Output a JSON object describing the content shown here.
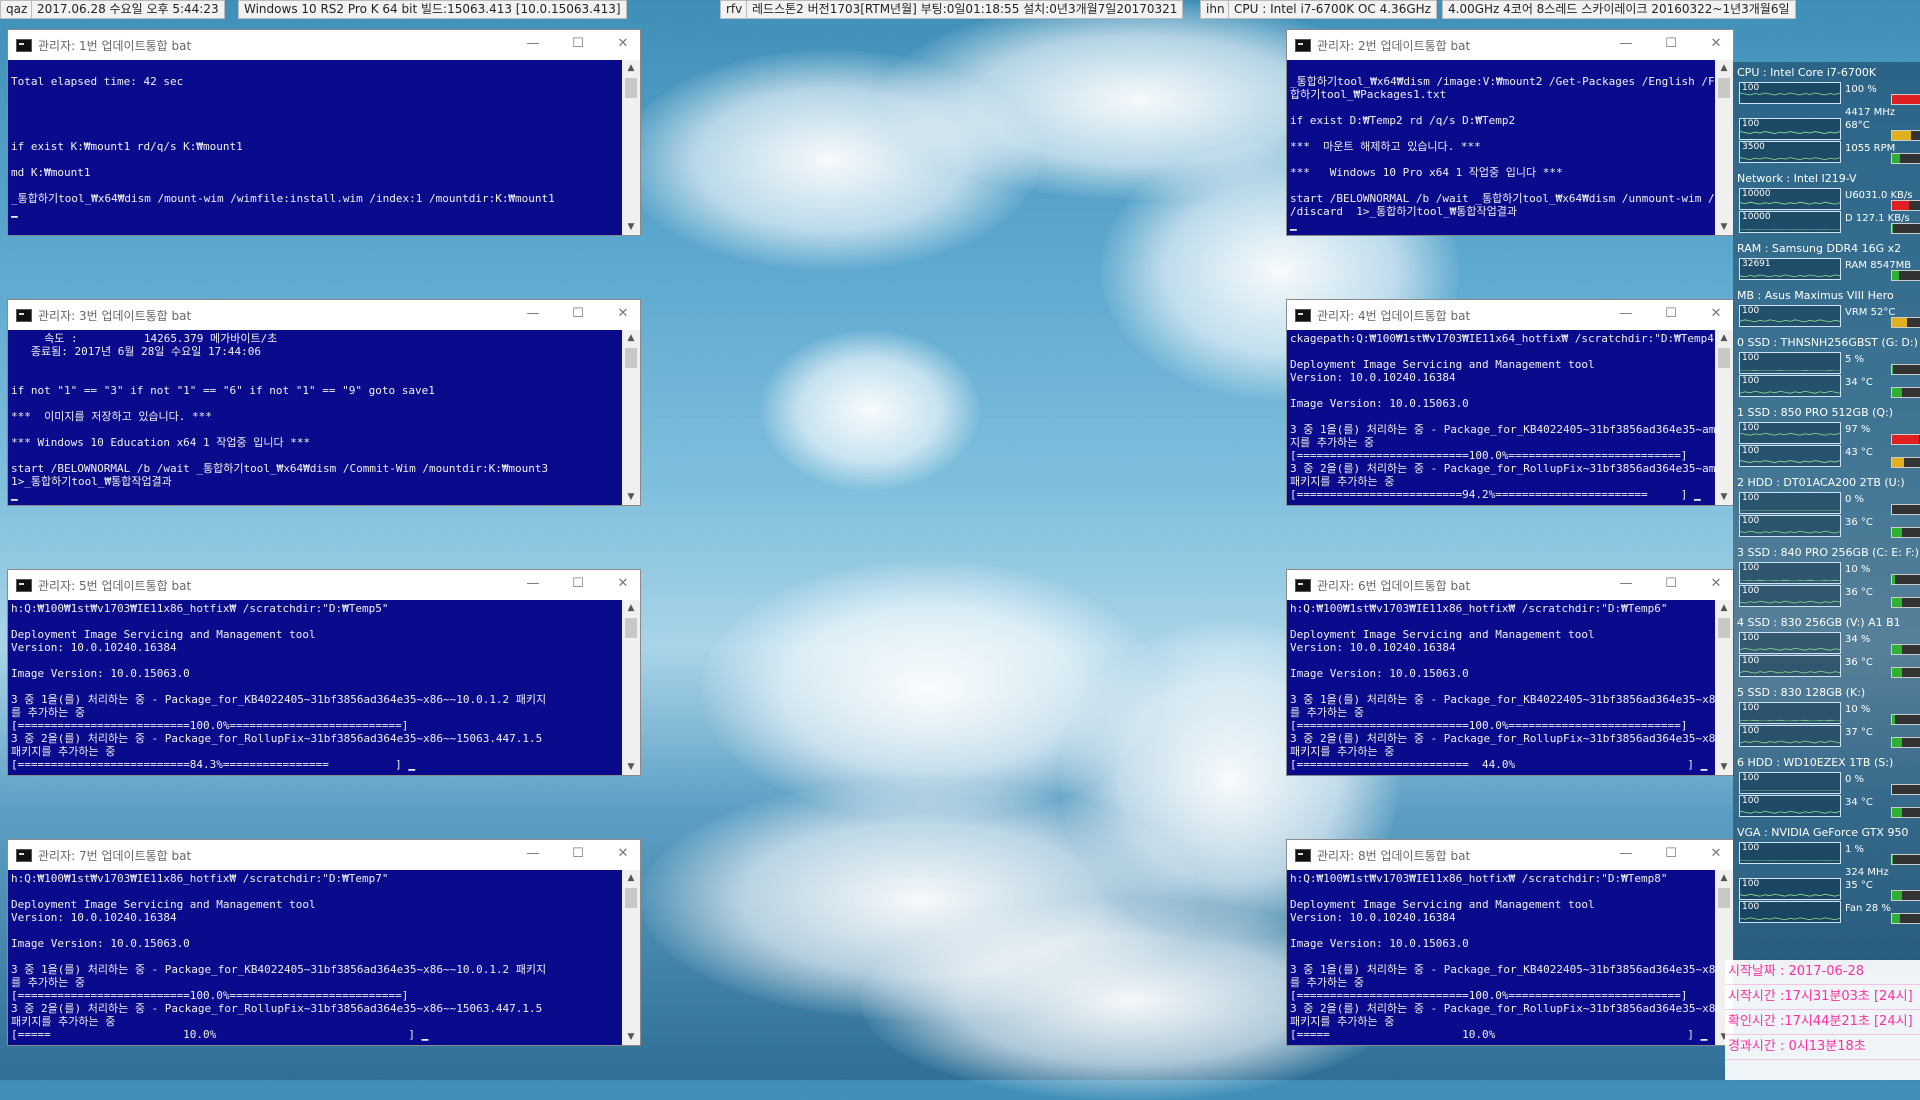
{
  "topbar": {
    "items": [
      "qaz",
      "2017.06.28 수요일  오후 5:44:23",
      "Windows 10 RS2 Pro K 64 bit 빌드:15063.413 [10.0.15063.413]",
      "rfv",
      "레드스톤2 버전1703[RTM년월] 부팅:0일01:18:55 설치:0년3개월7일20170321",
      "ihn",
      "CPU : Intel i7-6700K OC 4.36GHz",
      "4.00GHz 4코어 8스레드 스카이레이크 20160322~1년3개월6일"
    ]
  },
  "windows": [
    {
      "title": "관리자:  1번 업데이트통합 bat",
      "lines": [
        "",
        "Total elapsed time: 42 sec",
        "",
        "",
        "",
        "",
        "if exist K:₩mount1 rd/q/s K:₩mount1",
        "",
        "md K:₩mount1",
        "",
        "_통합하기tool_₩x64₩dism /mount-wim /wimfile:install.wim /index:1 /mountdir:K:₩mount1",
        "▁"
      ]
    },
    {
      "title": "관리자:  2번 업데이트통합 bat",
      "lines": [
        "",
        "_통합하기tool_₩x64₩dism /image:V:₩mount2 /Get-Packages /English /Format:Table >_통",
        "합하기tool_₩Packages1.txt",
        "",
        "if exist D:₩Temp2 rd /q/s D:₩Temp2",
        "",
        "***  마운트 해제하고 있습니다. ***",
        "",
        "***   Windows 10 Pro x64 1 작업중 입니다 ***",
        "",
        "start /BELOWNORMAL /b /wait _통합하기tool_₩x64₩dism /unmount-wim /mountdir:V:₩mount2",
        "/discard  1>_통합하기tool_₩통합작업결과",
        "▁"
      ]
    },
    {
      "title": "관리자:  3번 업데이트통합 bat",
      "lines": [
        "     속도 :          14265.379 메가바이트/초",
        "   종료됨: 2017년 6월 28일 수요일 17:44:06",
        "",
        "",
        "if not \"1\" == \"3\" if not \"1\" == \"6\" if not \"1\" == \"9\" goto save1",
        "",
        "***  이미지를 저장하고 있습니다. ***",
        "",
        "*** Windows 10 Education x64 1 작업중 입니다 ***",
        "",
        "start /BELOWNORMAL /b /wait _통합하기tool_₩x64₩dism /Commit-Wim /mountdir:K:₩mount3",
        "1>_통합하기tool_₩통합작업결과",
        "▁"
      ]
    },
    {
      "title": "관리자:  4번 업데이트통합 bat",
      "lines": [
        "ckagepath:Q:₩100₩1st₩v1703₩IE11x64_hotfix₩ /scratchdir:\"D:₩Temp4\"",
        "",
        "Deployment Image Servicing and Management tool",
        "Version: 10.0.10240.16384",
        "",
        "Image Version: 10.0.15063.0",
        "",
        "3 중 1을(를) 처리하는 중 - Package_for_KB4022405~31bf3856ad364e35~amd64~~10.0.1.2 패키",
        "지를 추가하는 중",
        "[==========================100.0%==========================]",
        "3 중 2을(를) 처리하는 중 - Package_for_RollupFix~31bf3856ad364e35~amd64~~15063.447.1.5",
        "패키지를 추가하는 중",
        "[=========================94.2%=======================     ] ▁"
      ]
    },
    {
      "title": "관리자:  5번 업데이트통합 bat",
      "lines": [
        "h:Q:₩100₩1st₩v1703₩IE11x86_hotfix₩ /scratchdir:\"D:₩Temp5\"",
        "",
        "Deployment Image Servicing and Management tool",
        "Version: 10.0.10240.16384",
        "",
        "Image Version: 10.0.15063.0",
        "",
        "3 중 1을(를) 처리하는 중 - Package_for_KB4022405~31bf3856ad364e35~x86~~10.0.1.2 패키지",
        "를 추가하는 중",
        "[==========================100.0%==========================]",
        "3 중 2을(를) 처리하는 중 - Package_for_RollupFix~31bf3856ad364e35~x86~~15063.447.1.5",
        "패키지를 추가하는 중",
        "[==========================84.3%================          ] ▁"
      ]
    },
    {
      "title": "관리자:  6번 업데이트통합 bat",
      "lines": [
        "h:Q:₩100₩1st₩v1703₩IE11x86_hotfix₩ /scratchdir:\"D:₩Temp6\"",
        "",
        "Deployment Image Servicing and Management tool",
        "Version: 10.0.10240.16384",
        "",
        "Image Version: 10.0.15063.0",
        "",
        "3 중 1을(를) 처리하는 중 - Package_for_KB4022405~31bf3856ad364e35~x86~~10.0.1.2 패키지",
        "를 추가하는 중",
        "[==========================100.0%==========================]",
        "3 중 2을(를) 처리하는 중 - Package_for_RollupFix~31bf3856ad364e35~x86~~15063.447.1.5",
        "패키지를 추가하는 중",
        "[==========================  44.0%                          ] ▁"
      ]
    },
    {
      "title": "관리자:  7번 업데이트통합 bat",
      "lines": [
        "h:Q:₩100₩1st₩v1703₩IE11x86_hotfix₩ /scratchdir:\"D:₩Temp7\"",
        "",
        "Deployment Image Servicing and Management tool",
        "Version: 10.0.10240.16384",
        "",
        "Image Version: 10.0.15063.0",
        "",
        "3 중 1을(를) 처리하는 중 - Package_for_KB4022405~31bf3856ad364e35~x86~~10.0.1.2 패키지",
        "를 추가하는 중",
        "[==========================100.0%==========================]",
        "3 중 2을(를) 처리하는 중 - Package_for_RollupFix~31bf3856ad364e35~x86~~15063.447.1.5",
        "패키지를 추가하는 중",
        "[=====                    10.0%                             ] ▁"
      ]
    },
    {
      "title": "관리자:  8번 업데이트통합 bat",
      "lines": [
        "h:Q:₩100₩1st₩v1703₩IE11x86_hotfix₩ /scratchdir:\"D:₩Temp8\"",
        "",
        "Deployment Image Servicing and Management tool",
        "Version: 10.0.10240.16384",
        "",
        "Image Version: 10.0.15063.0",
        "",
        "3 중 1을(를) 처리하는 중 - Package_for_KB4022405~31bf3856ad364e35~x86~~10.0.1.2 패키지",
        "를 추가하는 중",
        "[==========================100.0%==========================]",
        "3 중 2을(를) 처리하는 중 - Package_for_RollupFix~31bf3856ad364e35~x86~~15063.447.1.5",
        "패키지를 추가하는 중",
        "[=====                    10.0%                             ] ▁"
      ]
    }
  ],
  "monitor": {
    "sections": [
      {
        "head": "CPU : Intel Core i7-6700K",
        "rows": [
          {
            "g": "100",
            "v": "100 %",
            "fill": 1.0,
            "color": "#e02020"
          },
          {
            "g": "",
            "v": "4417 MHz",
            "fill": 0,
            "color": ""
          },
          {
            "g": "100",
            "v": "68°C",
            "fill": 0.68,
            "color": "#e0b020"
          },
          {
            "g": "3500",
            "v": "1055 RPM",
            "fill": 0.3,
            "color": "#30b030"
          }
        ]
      },
      {
        "head": "Network : Intel I219-V",
        "rows": [
          {
            "g": "10000",
            "v": "U6031.0 KB/s",
            "fill": 0.6,
            "color": "#e02020"
          },
          {
            "g": "10000",
            "v": "D  127.1 KB/s",
            "fill": 0.02,
            "color": "#30b030"
          }
        ]
      },
      {
        "head": "RAM : Samsung DDR4 16G x2",
        "rows": [
          {
            "g": "32691",
            "v": "RAM  8547MB",
            "fill": 0.26,
            "color": "#30b030"
          }
        ]
      },
      {
        "head": "MB : Asus Maximus VIII Hero",
        "rows": [
          {
            "g": "100",
            "v": "VRM  52°C",
            "fill": 0.52,
            "color": "#e0b020"
          }
        ]
      },
      {
        "head": "0 SSD : THNSNH256GBST (G: D:)",
        "rows": [
          {
            "g": "100",
            "v": "5 %",
            "fill": 0.05,
            "color": "#30b030"
          },
          {
            "g": "100",
            "v": "34 °C",
            "fill": 0.34,
            "color": "#30b030"
          }
        ]
      },
      {
        "head": "1 SSD : 850 PRO 512GB (Q:)",
        "rows": [
          {
            "g": "100",
            "v": "97 %",
            "fill": 0.97,
            "color": "#e02020"
          },
          {
            "g": "100",
            "v": "43 °C",
            "fill": 0.43,
            "color": "#e0b020"
          }
        ]
      },
      {
        "head": "2 HDD : DT01ACA200 2TB (U:)",
        "rows": [
          {
            "g": "100",
            "v": "0 %",
            "fill": 0,
            "color": "#30b030"
          },
          {
            "g": "100",
            "v": "36 °C",
            "fill": 0.36,
            "color": "#30b030"
          }
        ]
      },
      {
        "head": "3 SSD : 840 PRO 256GB (C: E: F:)",
        "rows": [
          {
            "g": "100",
            "v": "10 %",
            "fill": 0.1,
            "color": "#30b030"
          },
          {
            "g": "100",
            "v": "36 °C",
            "fill": 0.36,
            "color": "#30b030"
          }
        ]
      },
      {
        "head": "4 SSD : 830 256GB (V:) A1 B1",
        "rows": [
          {
            "g": "100",
            "v": "34 %",
            "fill": 0.34,
            "color": "#30b030"
          },
          {
            "g": "100",
            "v": "36 °C",
            "fill": 0.36,
            "color": "#30b030"
          }
        ]
      },
      {
        "head": "5 SSD : 830 128GB (K:)",
        "rows": [
          {
            "g": "100",
            "v": "10 %",
            "fill": 0.1,
            "color": "#30b030"
          },
          {
            "g": "100",
            "v": "37 °C",
            "fill": 0.37,
            "color": "#30b030"
          }
        ]
      },
      {
        "head": "6 HDD : WD10EZEX 1TB (S:)",
        "rows": [
          {
            "g": "100",
            "v": "0 %",
            "fill": 0,
            "color": "#30b030"
          },
          {
            "g": "100",
            "v": "34 °C",
            "fill": 0.34,
            "color": "#30b030"
          }
        ]
      },
      {
        "head": "VGA : NVIDIA GeForce GTX 950",
        "rows": [
          {
            "g": "100",
            "v": "1 %",
            "fill": 0.01,
            "color": "#30b030"
          },
          {
            "g": "",
            "v": "324 MHz",
            "fill": 0,
            "color": ""
          },
          {
            "g": "100",
            "v": "35 °C",
            "fill": 0.35,
            "color": "#30b030"
          },
          {
            "g": "100",
            "v": "Fan 28 %",
            "fill": 0.28,
            "color": "#30b030"
          }
        ]
      }
    ]
  },
  "info": {
    "lines": [
      "시작날짜 : 2017-06-28",
      "시작시간 :17시31분03초 [24시]",
      "확인시간 :17시44분21초 [24시]",
      "경과시간 : 0시13분18초"
    ]
  }
}
